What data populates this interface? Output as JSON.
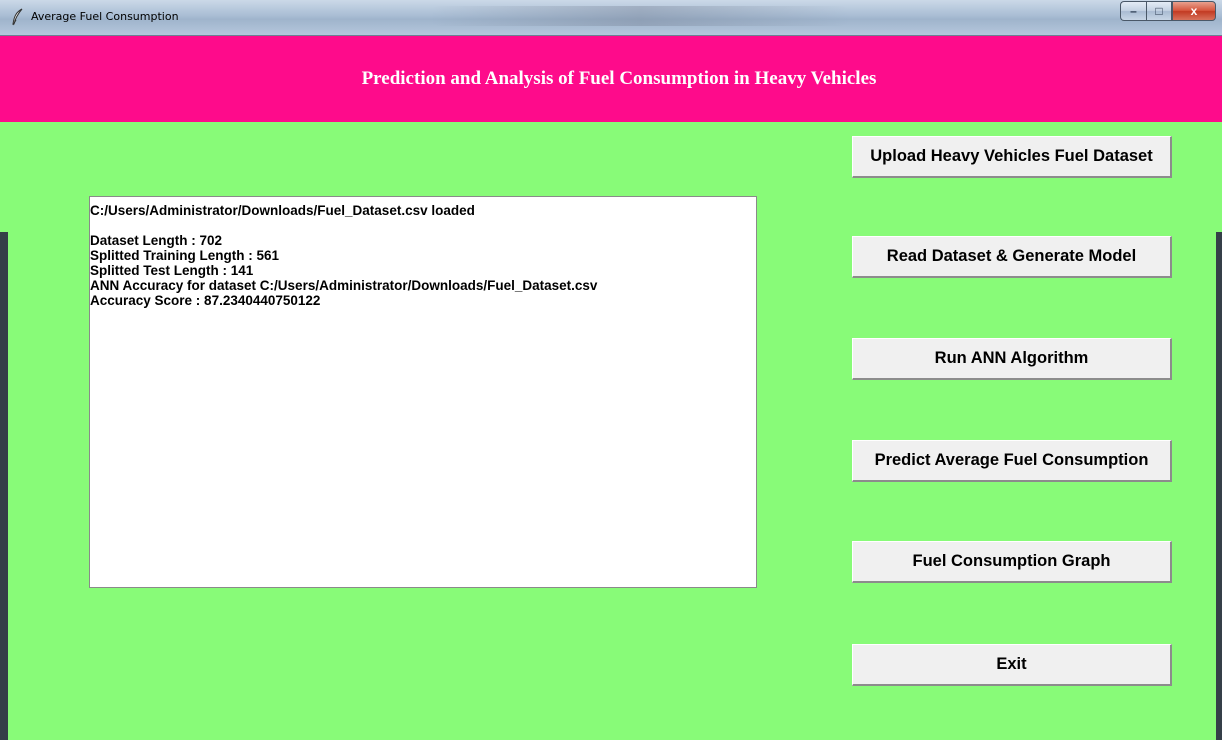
{
  "window": {
    "title": "Average Fuel Consumption",
    "header_title": "Prediction and Analysis of Fuel Consumption in Heavy Vehicles"
  },
  "controls": {
    "minimize": "–",
    "maximize": "□",
    "close": "x"
  },
  "output": {
    "line_1": "C:/Users/Administrator/Downloads/Fuel_Dataset.csv loaded",
    "line_2": "Dataset Length : 702",
    "line_3": "Splitted Training Length : 561",
    "line_4": "Splitted Test Length : 141",
    "line_5": "ANN Accuracy for dataset C:/Users/Administrator/Downloads/Fuel_Dataset.csv",
    "line_6": "Accuracy Score : 87.2340440750122"
  },
  "buttons": {
    "upload": "Upload Heavy Vehicles Fuel Dataset",
    "read": "Read Dataset & Generate Model",
    "run_ann": "Run ANN Algorithm",
    "predict": "Predict Average Fuel Consumption",
    "graph": "Fuel Consumption Graph",
    "exit": "Exit"
  },
  "colors": {
    "background": "#88fb78",
    "header": "#fe0b8b",
    "header_text": "#ffffff"
  },
  "icons": {
    "app": "feather-icon"
  }
}
